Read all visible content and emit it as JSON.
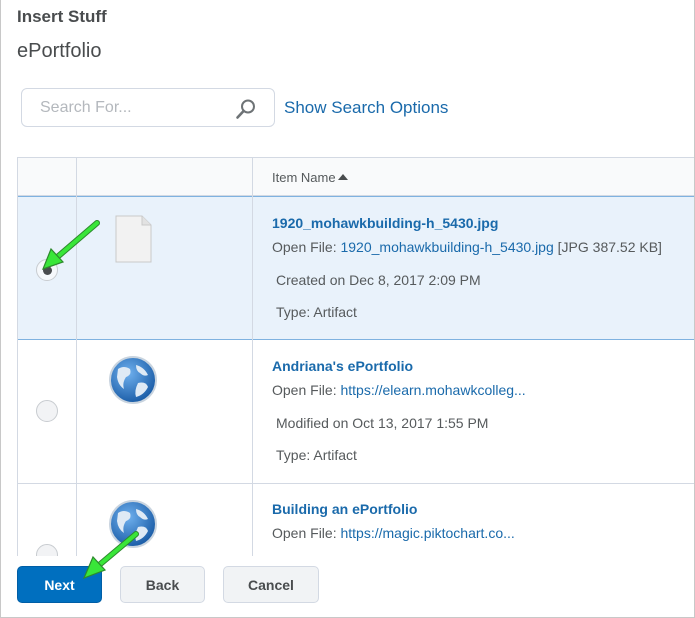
{
  "dialog": {
    "title": "Insert Stuff"
  },
  "page": {
    "title": "ePortfolio"
  },
  "search": {
    "placeholder": "Search For...",
    "value": "",
    "options_link": "Show Search Options"
  },
  "table": {
    "column_header": "Item Name",
    "rows": [
      {
        "name": "1920_mohawkbuilding-h_5430.jpg",
        "open_label": "Open File:",
        "open_link": "1920_mohawkbuilding-h_5430.jpg",
        "file_info": "[JPG  387.52 KB]",
        "date": "Created on Dec 8, 2017 2:09 PM",
        "type": "Type: Artifact",
        "icon": "file-icon",
        "selected": true
      },
      {
        "name": "Andriana's ePortfolio",
        "open_label": "Open File:",
        "open_link": "https://elearn.mohawkcolleg...",
        "date": "Modified on Oct 13, 2017 1:55 PM",
        "type": "Type: Artifact",
        "icon": "globe-icon",
        "selected": false
      },
      {
        "name": "Building an ePortfolio",
        "open_label": "Open File:",
        "open_link": "https://magic.piktochart.co...",
        "icon": "globe-icon",
        "selected": false
      }
    ]
  },
  "footer": {
    "next_label": "Next",
    "back_label": "Back",
    "cancel_label": "Cancel"
  },
  "colors": {
    "primary": "#006fbf",
    "link": "#1a6aab",
    "selected_row": "#e9f2fb",
    "arrow": "#39e639"
  }
}
